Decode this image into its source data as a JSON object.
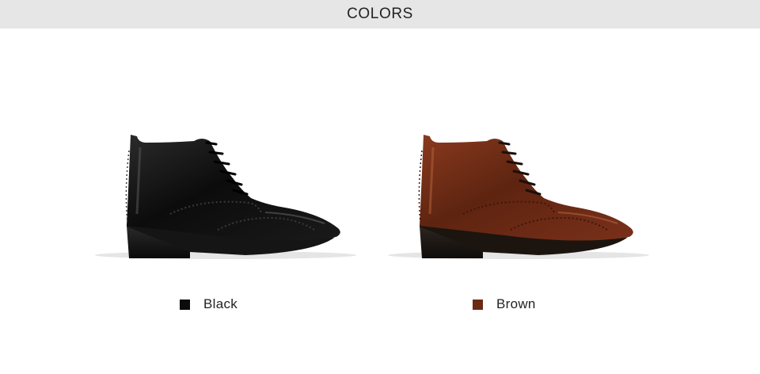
{
  "header": {
    "title": "COLORS"
  },
  "variants": [
    {
      "label": "Black",
      "swatch_color": "#0b0b0b",
      "image_icon": "black-brogue-ankle-boot"
    },
    {
      "label": "Brown",
      "swatch_color": "#6b2a14",
      "image_icon": "brown-brogue-ankle-boot"
    }
  ],
  "colors": {
    "header_bg": "#e6e6e6",
    "page_bg": "#ffffff",
    "text": "#222222"
  }
}
